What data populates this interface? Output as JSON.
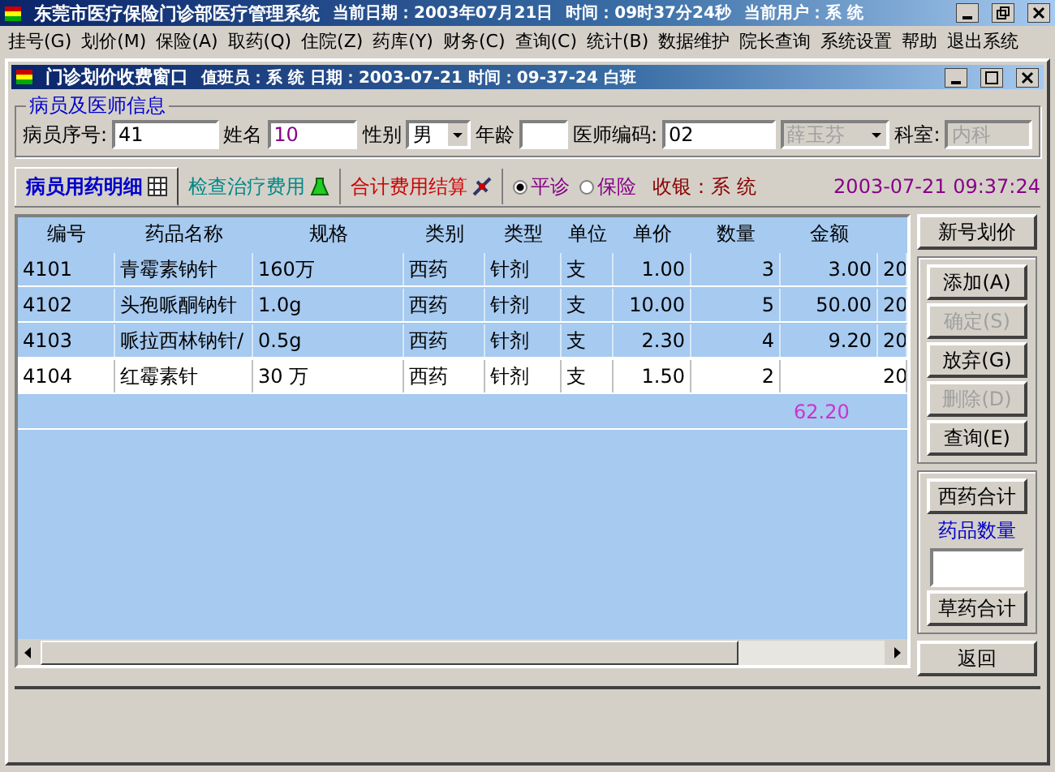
{
  "app_window": {
    "title": "东莞市医疗保险门诊部医疗管理系统",
    "date_text": "当前日期：2003年07月21日",
    "time_text": "时间：09时37分24秒",
    "user_text": "当前用户：系 统"
  },
  "menu": [
    "挂号(G)",
    "划价(M)",
    "保险(A)",
    "取药(Q)",
    "住院(Z)",
    "药库(Y)",
    "财务(C)",
    "查询(C)",
    "统计(B)",
    "数据维护",
    "院长查询",
    "系统设置",
    "帮助",
    "退出系统"
  ],
  "window": {
    "title": "门诊划价收费窗口",
    "info": "值班员：系 统  日期：2003-07-21 时间：09-37-24   白班"
  },
  "patient_group": {
    "title": "病员及医师信息",
    "fields": [
      {
        "kind": "input",
        "label": "病员序号:",
        "value": "41",
        "disabled": false
      },
      {
        "kind": "input",
        "label": "姓名",
        "value": "10",
        "disabled": false
      },
      {
        "kind": "select",
        "label": "性别",
        "value": "男",
        "disabled": false
      },
      {
        "kind": "input",
        "label": "年龄",
        "disabled": false
      },
      {
        "kind": "input",
        "label": "医师编码:",
        "value": "02",
        "disabled": false
      },
      {
        "kind": "select",
        "value": "薛玉芬",
        "disabled": true
      },
      {
        "kind": "input",
        "label": "科室:",
        "value": "内科",
        "disabled": true
      }
    ]
  },
  "tabs": [
    {
      "label": "病员用药明细",
      "selected": true
    },
    {
      "label": "检查治疗费用",
      "selected": false
    },
    {
      "label": "合计费用结算",
      "selected": false
    }
  ],
  "visit_types": [
    {
      "label": "平诊",
      "selected": true
    },
    {
      "label": "保险",
      "selected": false
    }
  ],
  "cashier": "收银：系 统",
  "timestamp": "2003-07-21  09:37:24",
  "table": {
    "columns": [
      "编号",
      "药品名称",
      "规格",
      "类别",
      "类型",
      "单位",
      "单价",
      "数量",
      "金额",
      ""
    ],
    "rows": [
      {
        "selected": false,
        "cells": [
          "4101",
          "青霉素钠针",
          "160万",
          "西药",
          "针剂",
          "支",
          "1.00",
          "3",
          "3.00",
          "20"
        ]
      },
      {
        "selected": false,
        "cells": [
          "4102",
          "头孢哌酮钠针",
          "1.0g",
          "西药",
          "针剂",
          "支",
          "10.00",
          "5",
          "50.00",
          "20"
        ]
      },
      {
        "selected": false,
        "cells": [
          "4103",
          "哌拉西林钠针/",
          "0.5g",
          "西药",
          "针剂",
          "支",
          "2.30",
          "4",
          "9.20",
          "20"
        ]
      },
      {
        "selected": true,
        "cells": [
          "4104",
          "红霉素针",
          "30 万",
          "西药",
          "针剂",
          "支",
          "1.50",
          "2",
          "",
          "20"
        ]
      }
    ],
    "total": "62.20"
  },
  "new_button": "新号划价",
  "action_buttons": [
    {
      "label": "添加(A)",
      "disabled": false
    },
    {
      "label": "确定(S)",
      "disabled": true
    },
    {
      "label": "放弃(G)",
      "disabled": false
    },
    {
      "label": "删除(D)",
      "disabled": true
    },
    {
      "label": "查询(E)",
      "disabled": false
    }
  ],
  "totals_panel": {
    "west_button": "西药合计",
    "count_label": "药品数量",
    "herbal_button": "草药合计"
  },
  "back_button": "返回"
}
